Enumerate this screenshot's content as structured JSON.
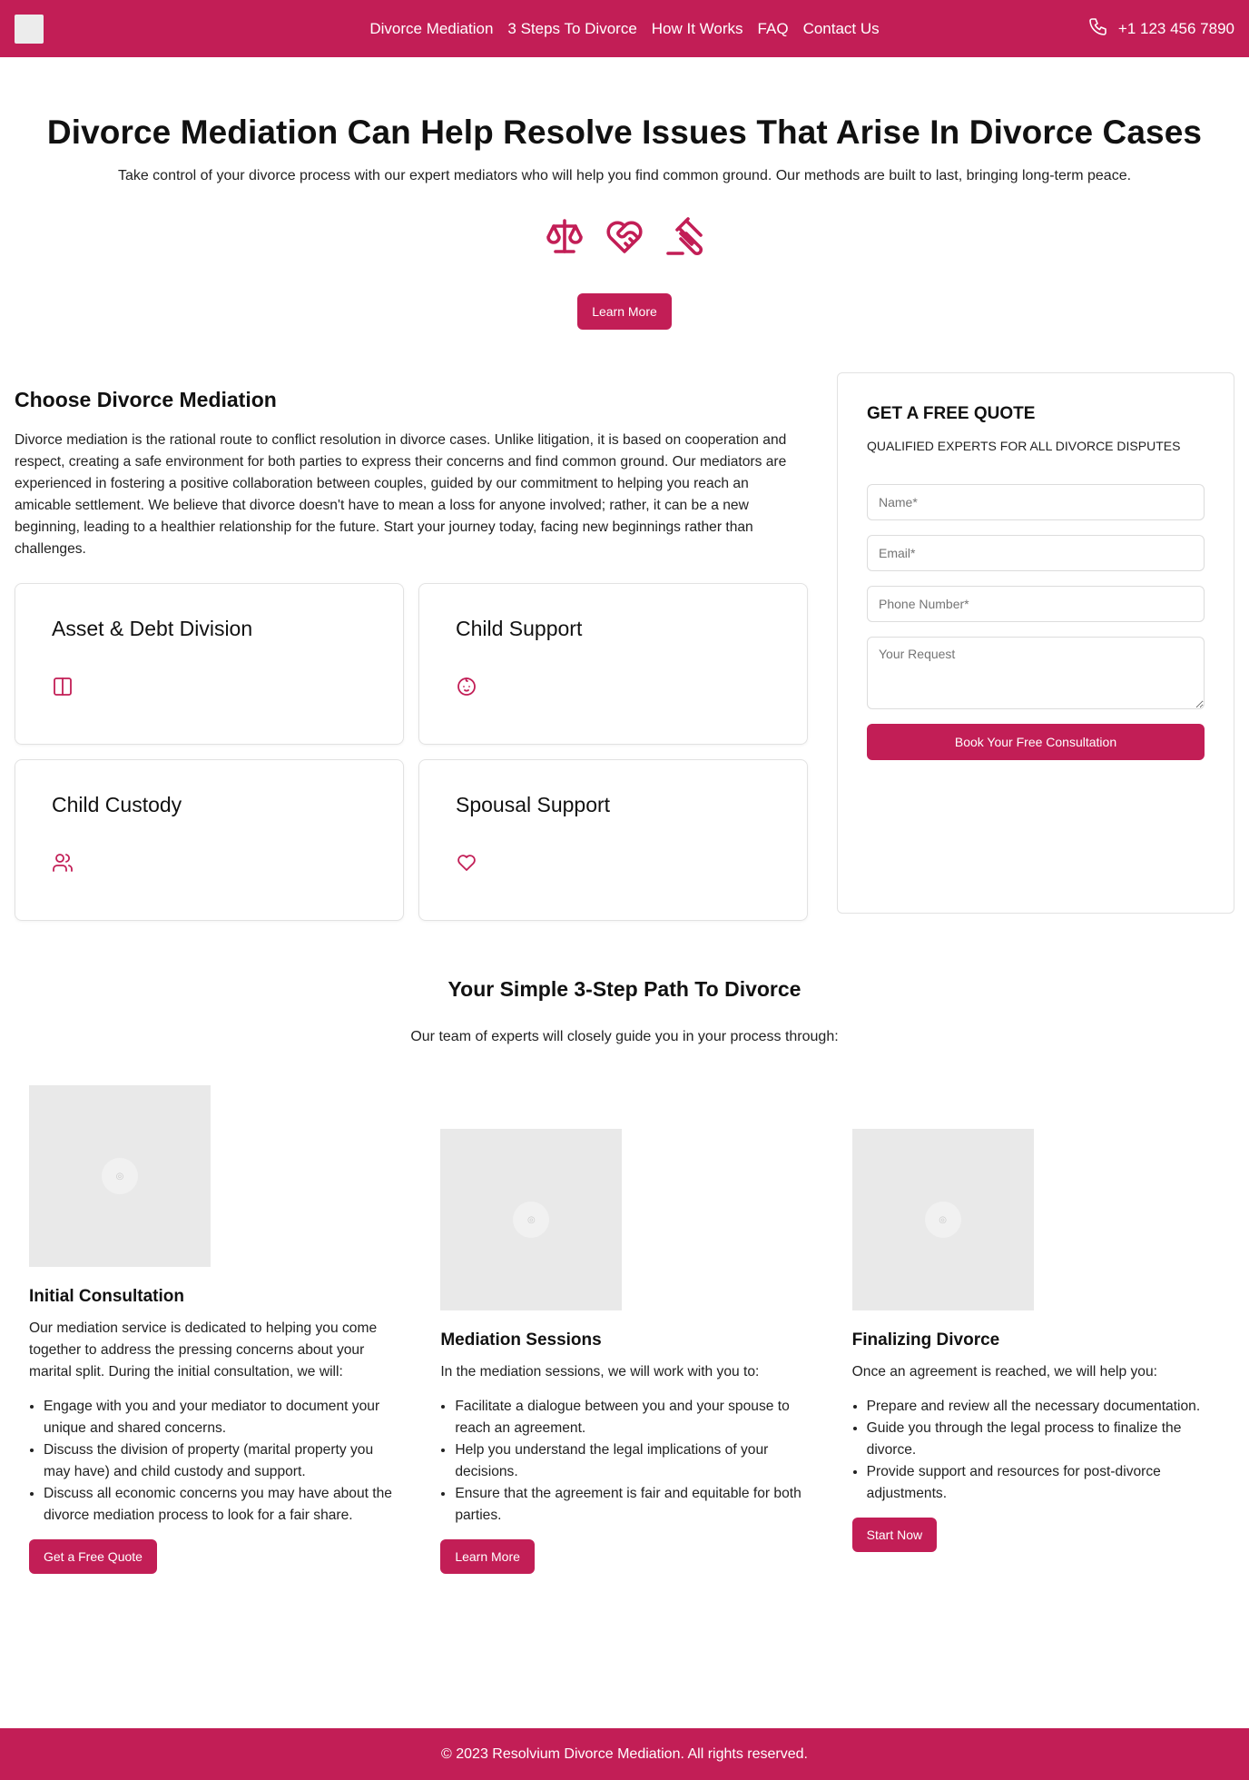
{
  "nav": {
    "links": [
      "Divorce Mediation",
      "3 Steps To Divorce",
      "How It Works",
      "FAQ",
      "Contact Us"
    ],
    "phone": "+1 123 456 7890"
  },
  "hero": {
    "title": "Divorce Mediation Can Help Resolve Issues That Arise In Divorce Cases",
    "subtitle": "Take control of your divorce process with our expert mediators who will help you find common ground. Our methods are built to last, bringing long-term peace.",
    "icons": [
      "scale-icon",
      "heart-handshake-icon",
      "gavel-icon"
    ],
    "cta": "Learn More"
  },
  "choose": {
    "title": "Choose Divorce Mediation",
    "description": "Divorce mediation is the rational route to conflict resolution in divorce cases. Unlike litigation, it is based on cooperation and respect, creating a safe environment for both parties to express their concerns and find common ground. Our mediators are experienced in fostering a positive collaboration between couples, guided by our commitment to helping you reach an amicable settlement. We believe that divorce doesn't have to mean a loss for anyone involved; rather, it can be a new beginning, leading to a healthier relationship for the future. Start your journey today, facing new beginnings rather than challenges.",
    "cards": [
      {
        "title": "Asset & Debt Division",
        "icon": "columns-icon"
      },
      {
        "title": "Child Support",
        "icon": "baby-icon"
      },
      {
        "title": "Child Custody",
        "icon": "users-icon"
      },
      {
        "title": "Spousal Support",
        "icon": "heart-icon"
      }
    ]
  },
  "quote": {
    "title": "GET A FREE QUOTE",
    "subtitle": "QUALIFIED EXPERTS FOR ALL DIVORCE DISPUTES",
    "name_placeholder": "Name*",
    "email_placeholder": "Email*",
    "phone_placeholder": "Phone Number*",
    "request_placeholder": "Your Request",
    "submit": "Book Your Free Consultation"
  },
  "steps": {
    "title": "Your Simple 3-Step Path To Divorce",
    "subtitle": "Our team of experts will closely guide you in your process through:",
    "items": [
      {
        "title": "Initial Consultation",
        "text": "Our mediation service is dedicated to helping you come together to address the pressing concerns about your marital split. During the initial consultation, we will:",
        "bullets": [
          "Engage with you and your mediator to document your unique and shared concerns.",
          "Discuss the division of property (marital property you may have) and child custody and support.",
          "Discuss all economic concerns you may have about the divorce mediation process to look for a fair share."
        ],
        "cta": "Get a Free Quote"
      },
      {
        "title": "Mediation Sessions",
        "text": "In the mediation sessions, we will work with you to:",
        "bullets": [
          "Facilitate a dialogue between you and your spouse to reach an agreement.",
          "Help you understand the legal implications of your decisions.",
          "Ensure that the agreement is fair and equitable for both parties."
        ],
        "cta": "Learn More"
      },
      {
        "title": "Finalizing Divorce",
        "text": "Once an agreement is reached, we will help you:",
        "bullets": [
          "Prepare and review all the necessary documentation.",
          "Guide you through the legal process to finalize the divorce.",
          "Provide support and resources for post-divorce adjustments."
        ],
        "cta": "Start Now"
      }
    ]
  },
  "footer": {
    "text": "© 2023 Resolvium Divorce Mediation. All rights reserved."
  },
  "colors": {
    "brand": "#c21e56",
    "text": "#111111",
    "border": "#e2e2e2"
  }
}
